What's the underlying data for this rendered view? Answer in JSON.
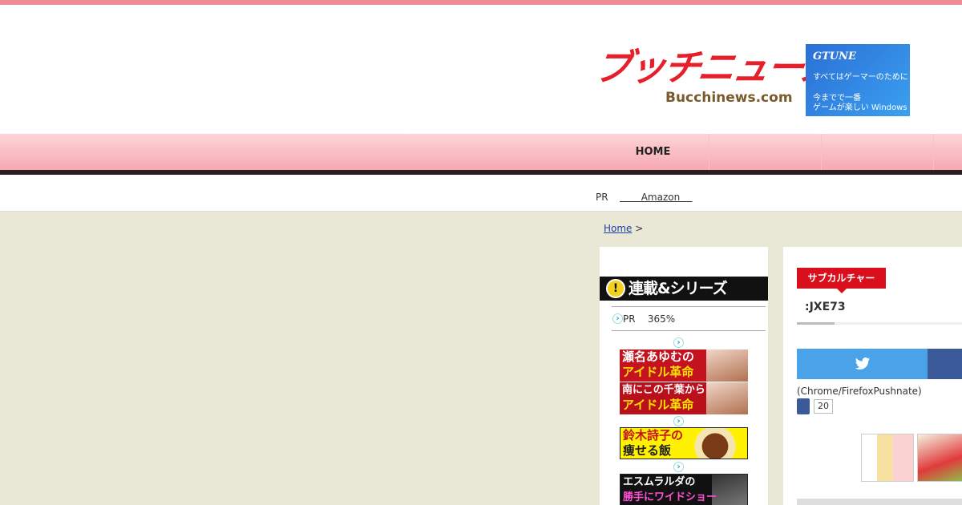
{
  "header": {
    "logo_text": "ブッチニュース",
    "logo_sub": "Bucchinews.com"
  },
  "ad": {
    "brand": "GTUNE",
    "line1": "すべてはゲーマーのために",
    "line2": "今までで一番",
    "line3": "ゲームが楽しい Windows へ"
  },
  "nav": {
    "home": "HOME"
  },
  "pr_bar": {
    "label": "PR",
    "link": "       Amazon    "
  },
  "breadcrumb": {
    "home": "Home",
    "sep": ">"
  },
  "sidebar": {
    "series_title": "連載&シリーズ",
    "pr_row": "PR    365%",
    "banners": [
      {
        "title": "瀬名あゆむの",
        "sub": "アイドル革命"
      },
      {
        "title": "南にこの千葉から",
        "sub": "アイドル革命"
      },
      {
        "title": "鈴木詩子の",
        "sub": "痩せる飯"
      },
      {
        "title": "エスムラルダの",
        "sub": "勝手にワイドショー"
      }
    ]
  },
  "article": {
    "category": "サブカルチャー",
    "title": ":JXE73",
    "push_note": "(Chrome/FirefoxPushnate)",
    "like_count": "20"
  },
  "colors": {
    "accent_red": "#d9101c",
    "nav_pink": "#f6a9b1",
    "twitter": "#4aa3e8",
    "facebook": "#3b5a9a",
    "page_bg": "#e9e7d5"
  }
}
